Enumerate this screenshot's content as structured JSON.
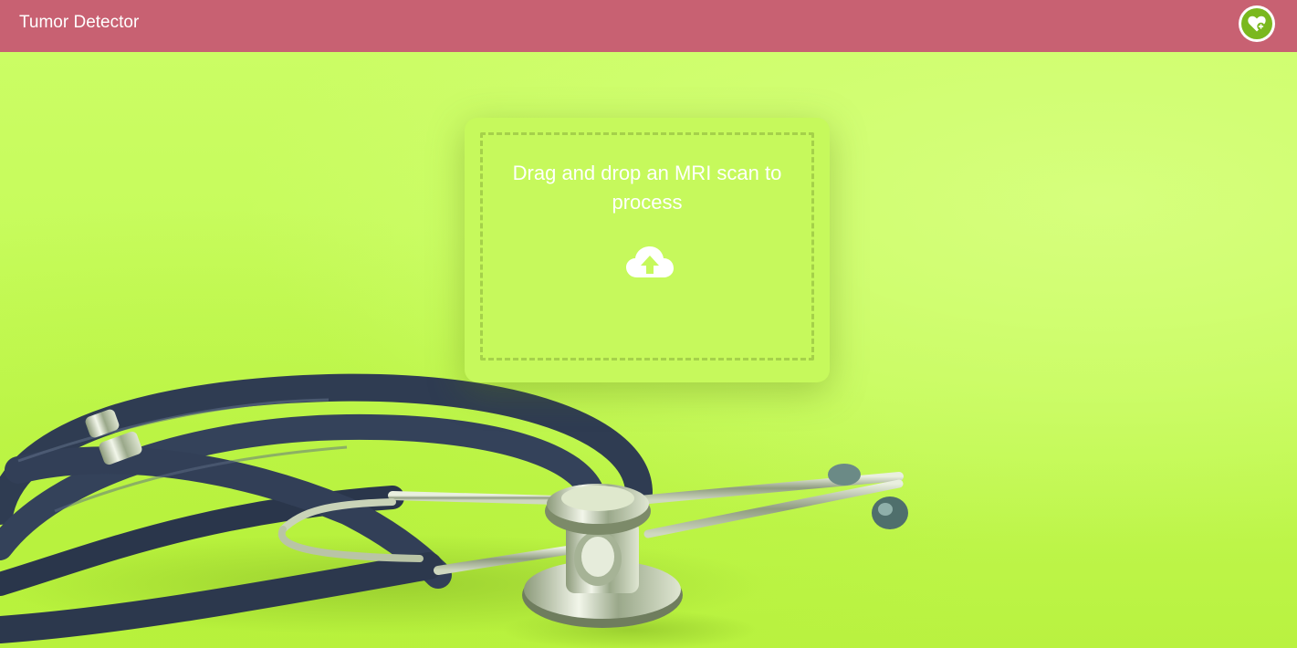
{
  "header": {
    "title": "Tumor Detector",
    "logo_icon": "heart-plus-icon"
  },
  "upload": {
    "prompt": "Drag and drop an MRI scan to process",
    "icon": "cloud-upload-icon"
  },
  "colors": {
    "header_bg": "#c86172",
    "background": "#c8fb5e",
    "logo_green": "#7ab81e",
    "text": "#ffffff"
  }
}
